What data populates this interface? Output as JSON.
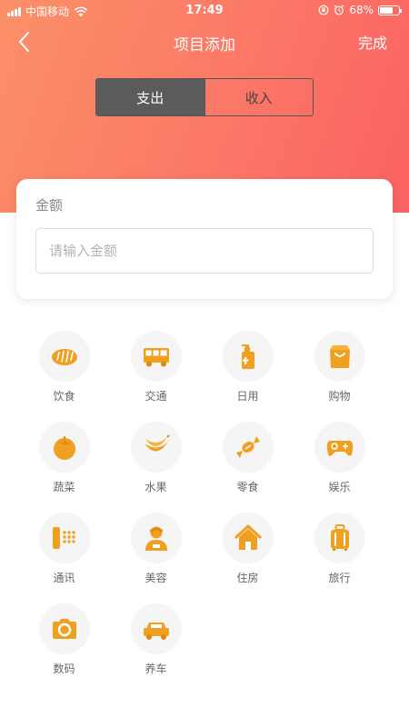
{
  "status_bar": {
    "carrier": "中国移动",
    "time": "17:49",
    "battery": "68%",
    "battery_level": 0.68
  },
  "nav": {
    "title": "项目添加",
    "done_label": "完成",
    "back_icon": "chevron-left-icon"
  },
  "segment": {
    "expense_label": "支出",
    "income_label": "收入",
    "active": "expense"
  },
  "amount": {
    "label": "金额",
    "placeholder": "请输入金额",
    "value": ""
  },
  "categories": [
    {
      "label": "饮食",
      "icon": "bread-icon"
    },
    {
      "label": "交通",
      "icon": "bus-icon"
    },
    {
      "label": "日用",
      "icon": "soap-bottle-icon"
    },
    {
      "label": "购物",
      "icon": "shopping-bag-icon"
    },
    {
      "label": "蔬菜",
      "icon": "tomato-icon"
    },
    {
      "label": "水果",
      "icon": "banana-icon"
    },
    {
      "label": "零食",
      "icon": "candy-icon"
    },
    {
      "label": "娱乐",
      "icon": "gamepad-icon"
    },
    {
      "label": "通讯",
      "icon": "phone-icon"
    },
    {
      "label": "美容",
      "icon": "beautician-icon"
    },
    {
      "label": "住房",
      "icon": "house-icon"
    },
    {
      "label": "旅行",
      "icon": "luggage-icon"
    },
    {
      "label": "数码",
      "icon": "camera-icon"
    },
    {
      "label": "养车",
      "icon": "car-icon"
    }
  ],
  "colors": {
    "header_start": "#fb9068",
    "header_end": "#fb6263",
    "icon_orange": "#f7a21b",
    "segment_active": "#5b5b5b"
  }
}
